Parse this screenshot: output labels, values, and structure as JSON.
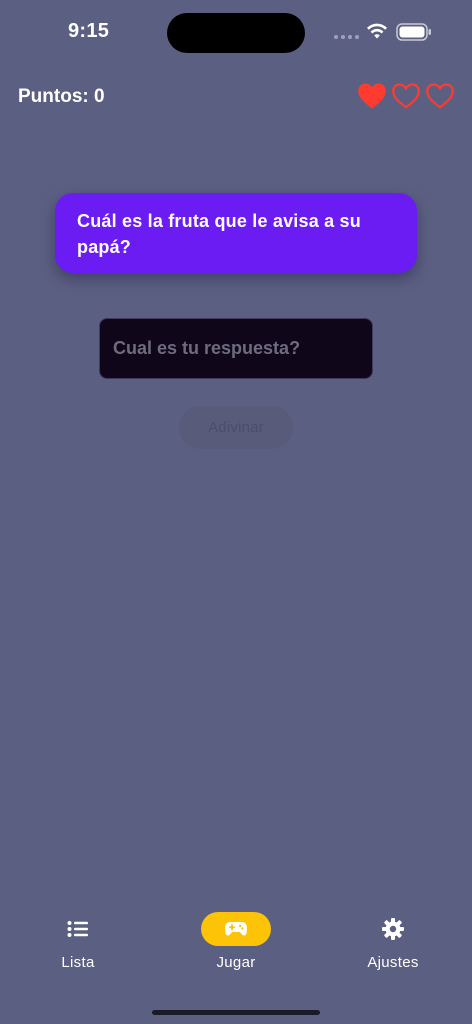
{
  "status_bar": {
    "time": "9:15"
  },
  "header": {
    "score_label": "Puntos: 0",
    "lives": {
      "filled": 1,
      "total": 3
    }
  },
  "question": {
    "text": "Cuál es la fruta que le avisa a su papá?"
  },
  "answer": {
    "value": "",
    "placeholder": "Cual es tu respuesta?"
  },
  "guess_button": {
    "label": "Adivinar"
  },
  "nav": {
    "items": [
      {
        "label": "Lista",
        "icon": "list-icon",
        "active": false
      },
      {
        "label": "Jugar",
        "icon": "gamepad-icon",
        "active": true
      },
      {
        "label": "Ajustes",
        "icon": "gear-icon",
        "active": false
      }
    ]
  },
  "colors": {
    "background": "#5b5f81",
    "card": "#6a1cf2",
    "heart": "#ff3b30",
    "active_nav": "#fdc307"
  }
}
